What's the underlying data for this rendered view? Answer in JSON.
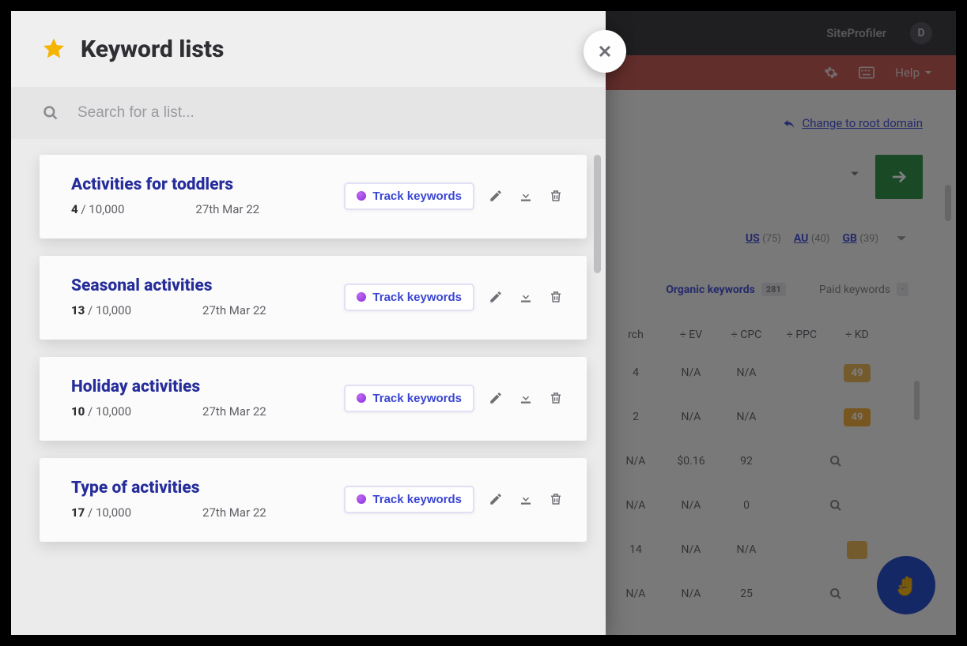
{
  "modal": {
    "title": "Keyword lists",
    "search_placeholder": "Search for a list...",
    "track_label": "Track keywords",
    "total_cap": "10,000",
    "lists": [
      {
        "title": "Activities for toddlers",
        "count": "4",
        "date": "27th Mar 22"
      },
      {
        "title": "Seasonal activities",
        "count": "13",
        "date": "27th Mar 22"
      },
      {
        "title": "Holiday activities",
        "count": "10",
        "date": "27th Mar 22"
      },
      {
        "title": "Type of activities",
        "count": "17",
        "date": "27th Mar 22"
      }
    ]
  },
  "bg": {
    "nav": {
      "siteprofiler": "SiteProfiler",
      "avatar_initial": "D"
    },
    "redbar": {
      "help": "Help"
    },
    "change_root": "Change to root domain",
    "countries": [
      {
        "code": "US",
        "count": "(75)"
      },
      {
        "code": "AU",
        "count": "(40)"
      },
      {
        "code": "GB",
        "count": "(39)"
      }
    ],
    "tabs": {
      "organic": "Organic keywords",
      "organic_badge": "281",
      "paid": "Paid keywords"
    },
    "table": {
      "headers": {
        "search": "rch",
        "ev": "EV",
        "cpc": "CPC",
        "ppc": "PPC",
        "kd": "KD"
      },
      "rows": [
        {
          "search": "4",
          "ev": "N/A",
          "cpc": "N/A",
          "ppc": "",
          "kd": "49",
          "kd_type": "na"
        },
        {
          "search": "2",
          "ev": "N/A",
          "cpc": "N/A",
          "ppc": "",
          "kd": "49",
          "kd_type": "badge"
        },
        {
          "search": "N/A",
          "ev": "$0.16",
          "cpc": "92",
          "ppc": "",
          "kd": "mag"
        },
        {
          "search": "N/A",
          "ev": "N/A",
          "cpc": "0",
          "ppc": "",
          "kd": "mag"
        },
        {
          "search": "14",
          "ev": "N/A",
          "cpc": "N/A",
          "ppc": "",
          "kd": "na-btn"
        },
        {
          "search": "N/A",
          "ev": "N/A",
          "cpc": "25",
          "ppc": "",
          "kd": "mag"
        }
      ]
    }
  }
}
